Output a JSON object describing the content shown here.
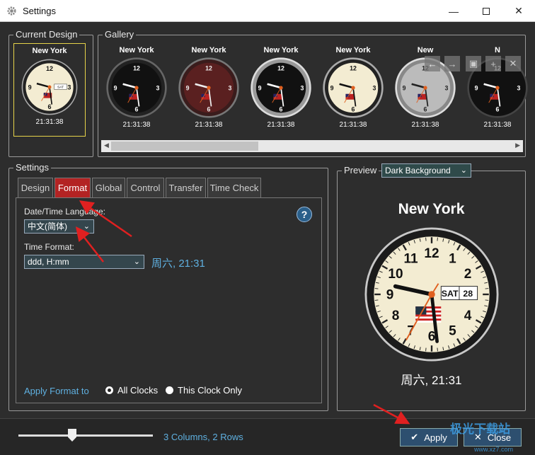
{
  "window": {
    "title": "Settings"
  },
  "current_design": {
    "legend": "Current Design",
    "city": "New York",
    "time": "21:31:38",
    "day": "SAT",
    "date": "28"
  },
  "gallery": {
    "legend": "Gallery",
    "items": [
      {
        "city": "New York",
        "time": "21:31:38"
      },
      {
        "city": "New York",
        "time": "21:31:38"
      },
      {
        "city": "New York",
        "time": "21:31:38"
      },
      {
        "city": "New York",
        "time": "21:31:38"
      },
      {
        "city": "New",
        "time": "21:31:38"
      },
      {
        "city": "N",
        "time": "21:31:38"
      }
    ]
  },
  "settings": {
    "legend": "Settings",
    "tabs": [
      "Design",
      "Format",
      "Global",
      "Control",
      "Transfer",
      "Time Check"
    ],
    "active_tab": "Format",
    "format": {
      "language_label": "Date/Time Language:",
      "language_value": "中文(简体)",
      "time_format_label": "Time Format:",
      "time_format_value": "ddd, H:mm",
      "time_format_sample": "周六, 21:31",
      "apply_label": "Apply Format to",
      "apply_all": "All Clocks",
      "apply_this": "This Clock Only",
      "help": "?"
    }
  },
  "preview": {
    "legend": "Preview",
    "background_value": "Dark Background",
    "city": "New York",
    "day": "SAT",
    "date": "28",
    "formatted": "周六, 21:31",
    "numbers": [
      "12",
      "1",
      "2",
      "3",
      "4",
      "5",
      "6",
      "7",
      "8",
      "9",
      "10",
      "11"
    ]
  },
  "bottom": {
    "layout_text": "3 Columns, 2 Rows",
    "apply": "Apply",
    "close": "Close",
    "watermark": "极光下载站",
    "watermark_url": "www.xz7.com"
  },
  "colors": {
    "accent_tab": "#b32323",
    "link": "#5fb0e0",
    "annot_arrow": "#e02020"
  }
}
